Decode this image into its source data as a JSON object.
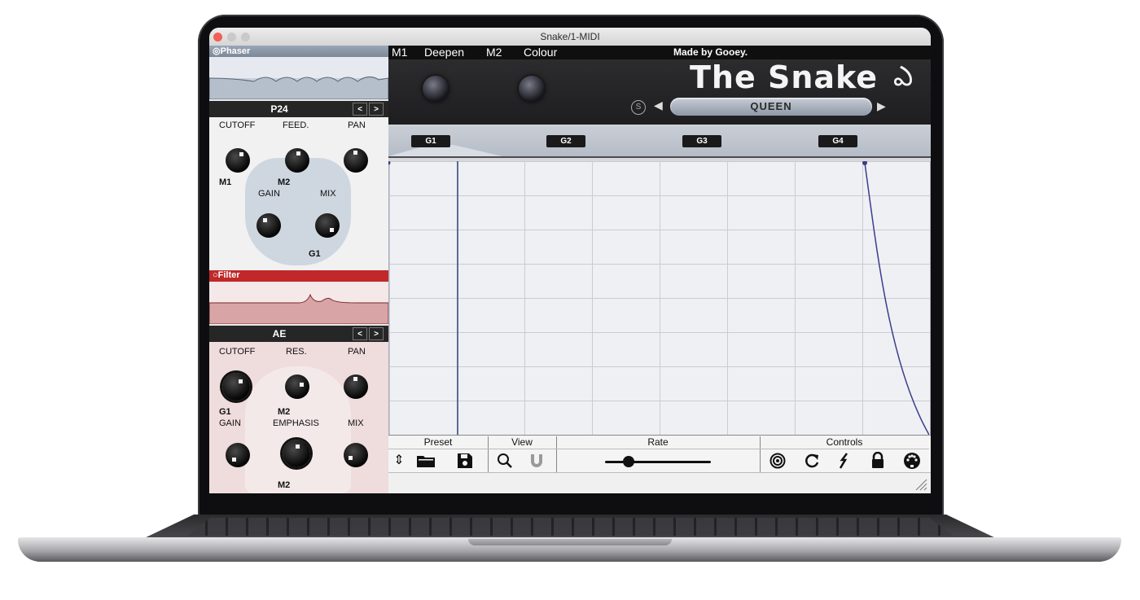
{
  "window": {
    "title": "Snake/1-MIDI"
  },
  "phaser": {
    "header": "Phaser",
    "preset": "P24",
    "prev": "<",
    "next": ">",
    "labels": {
      "cutoff": "CUTOFF",
      "feed": "FEED.",
      "pan": "PAN",
      "gain": "GAIN",
      "mix": "MIX"
    },
    "mod_labels": {
      "m1": "M1",
      "m2": "M2",
      "g1": "G1"
    }
  },
  "filter": {
    "header": "Filter",
    "preset": "AE",
    "prev": "<",
    "next": ">",
    "labels": {
      "cutoff": "CUTOFF",
      "res": "RES.",
      "pan": "PAN",
      "gain": "GAIN",
      "emphasis": "EMPHASIS",
      "mix": "MIX"
    },
    "mod_labels": {
      "g1": "G1",
      "m2a": "M2",
      "m2b": "M2"
    }
  },
  "topbar": {
    "m1": "M1",
    "m1_name": "Deepen",
    "m2": "M2",
    "m2_name": "Colour",
    "credit": "Made by Gooey."
  },
  "brand": {
    "title": "The Snake",
    "preset_name": "QUEEN",
    "s_badge": "S"
  },
  "groups": [
    "G1",
    "G2",
    "G3",
    "G4"
  ],
  "toolbar": {
    "preset": "Preset",
    "view": "View",
    "rate": "Rate",
    "controls": "Controls"
  },
  "colors": {
    "phaser_header": "#8a96a6",
    "filter_header": "#c0282a",
    "curve": "#3c3c8c"
  }
}
